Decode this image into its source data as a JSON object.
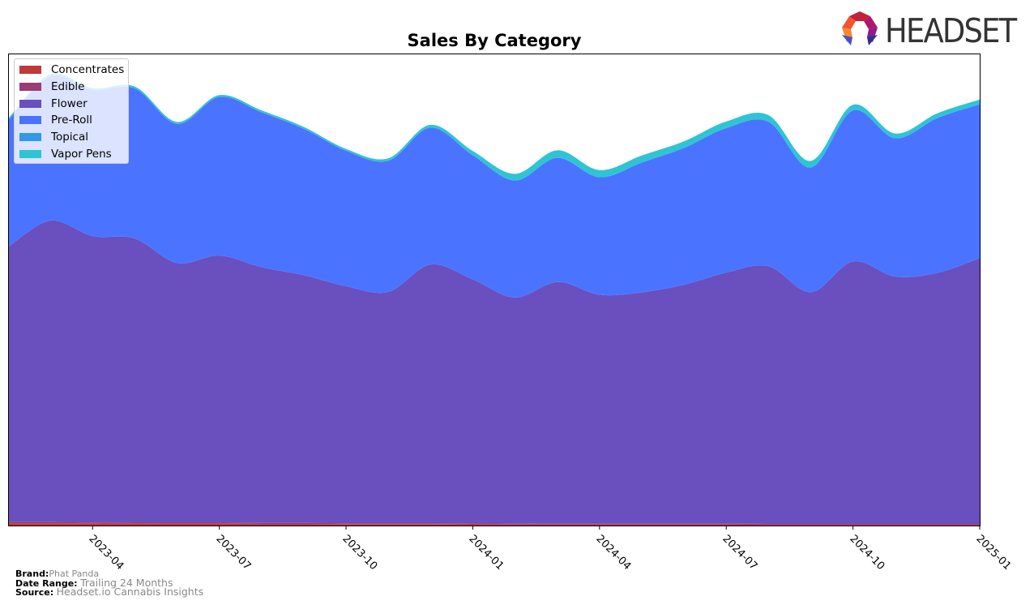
{
  "header": {
    "logo_text": "HEADSET"
  },
  "chart_data": {
    "type": "area",
    "stacked": true,
    "smoothed": true,
    "title": "Sales By Category",
    "xlabel": "",
    "ylabel": "",
    "y_axis_visible": false,
    "grid": false,
    "legend_position": "top-left",
    "x": [
      "2023-02",
      "2023-03",
      "2023-04",
      "2023-05",
      "2023-06",
      "2023-07",
      "2023-08",
      "2023-09",
      "2023-10",
      "2023-11",
      "2023-12",
      "2024-01",
      "2024-02",
      "2024-03",
      "2024-04",
      "2024-05",
      "2024-06",
      "2024-07",
      "2024-08",
      "2024-09",
      "2024-10",
      "2024-11",
      "2024-12",
      "2025-01"
    ],
    "x_tick_labels": [
      "2023-04",
      "2023-07",
      "2023-10",
      "2024-01",
      "2024-04",
      "2024-07",
      "2024-10",
      "2025-01"
    ],
    "ylim": [
      0,
      100
    ],
    "series": [
      {
        "name": "Concentrates",
        "color": "#c0383a",
        "values": [
          0.5,
          0.5,
          0.45,
          0.4,
          0.4,
          0.4,
          0.35,
          0.35,
          0.3,
          0.3,
          0.3,
          0.25,
          0.2,
          0.2,
          0.2,
          0.2,
          0.2,
          0.2,
          0.15,
          0.15,
          0.15,
          0.15,
          0.15,
          0.15
        ]
      },
      {
        "name": "Edible",
        "color": "#993d73",
        "values": [
          0.2,
          0.2,
          0.2,
          0.2,
          0.2,
          0.2,
          0.2,
          0.2,
          0.2,
          0.2,
          0.2,
          0.2,
          0.2,
          0.2,
          0.2,
          0.2,
          0.2,
          0.2,
          0.2,
          0.2,
          0.2,
          0.2,
          0.2,
          0.2
        ]
      },
      {
        "name": "Flower",
        "color": "#6a4fbf",
        "values": [
          58.3,
          63.9,
          60.7,
          60.2,
          55.0,
          56.6,
          54.2,
          52.5,
          50.2,
          49.0,
          54.8,
          51.7,
          47.9,
          51.2,
          48.5,
          49.0,
          50.6,
          53.2,
          54.6,
          49.1,
          55.6,
          52.4,
          53.2,
          56.3
        ]
      },
      {
        "name": "Pre-Roll",
        "color": "#4a74ff",
        "values": [
          26.8,
          30.6,
          30.9,
          31.8,
          29.5,
          33.6,
          32.8,
          31.0,
          28.7,
          27.8,
          29.0,
          26.3,
          24.8,
          26.3,
          24.9,
          27.5,
          29.0,
          30.6,
          30.6,
          26.4,
          32.0,
          29.3,
          32.8,
          32.6
        ]
      },
      {
        "name": "Topical",
        "color": "#3399e6",
        "values": [
          0,
          0,
          0,
          0,
          0,
          0,
          0,
          0,
          0,
          0,
          0,
          0,
          0,
          0,
          0,
          0,
          0,
          0,
          0,
          0,
          0,
          0,
          0,
          0
        ]
      },
      {
        "name": "Vapor Pens",
        "color": "#2ec4d4",
        "values": [
          0.4,
          0.4,
          0.4,
          0.4,
          0.4,
          0.4,
          0.4,
          0.4,
          0.4,
          0.5,
          0.6,
          0.9,
          1.4,
          1.6,
          1.5,
          1.5,
          1.4,
          1.4,
          1.4,
          1.4,
          1.2,
          1.0,
          1.0,
          1.0
        ]
      }
    ]
  },
  "footer": {
    "brand_label": "Brand:",
    "brand_value": "Phat Panda",
    "date_range_label": "Date Range:",
    "date_range_value": "Trailing 24 Months",
    "source_label": "Source:",
    "source_value": "Headset.io Cannabis Insights"
  }
}
